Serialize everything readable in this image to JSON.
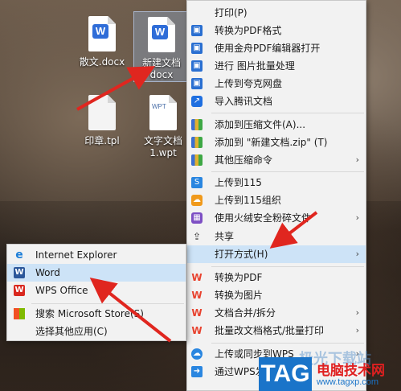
{
  "desktop": {
    "icons": [
      {
        "name": "散文.docx",
        "type": "word"
      },
      {
        "name": "新建文档",
        "name2": "docx",
        "type": "word"
      },
      {
        "name": "印章.tpl",
        "type": "file"
      },
      {
        "name": "文字文档",
        "name2": "1.wpt",
        "type": "wpt"
      }
    ]
  },
  "context_menu": {
    "items": [
      {
        "label": "打印(P)",
        "icon": "none"
      },
      {
        "label": "转换为PDF格式",
        "icon": "pdf-convert-icon"
      },
      {
        "label": "使用金舟PDF编辑器打开",
        "icon": "pdf-editor-icon"
      },
      {
        "label": "进行 图片批量处理",
        "icon": "image-batch-icon"
      },
      {
        "label": "上传到夸克网盘",
        "icon": "quark-cloud-icon"
      },
      {
        "label": "导入腾讯文档",
        "icon": "tencent-docs-icon"
      },
      {
        "label": "添加到压缩文件(A)...",
        "icon": "archive-icon"
      },
      {
        "label": "添加到 \"新建文档.zip\" (T)",
        "icon": "archive-zip-icon"
      },
      {
        "label": "其他压缩命令",
        "icon": "archive-more-icon",
        "submenu": true
      },
      {
        "label": "上传到115",
        "icon": "upload-115-icon"
      },
      {
        "label": "上传到115组织",
        "icon": "upload-115-org-icon"
      },
      {
        "label": "使用火绒安全粉碎文件",
        "icon": "huorong-shred-icon",
        "submenu": true
      },
      {
        "label": "共享",
        "icon": "share-icon"
      },
      {
        "label": "打开方式(H)",
        "icon": "none",
        "submenu": true
      },
      {
        "label": "转换为PDF",
        "icon": "wps-pdf-icon"
      },
      {
        "label": "转换为图片",
        "icon": "wps-image-icon"
      },
      {
        "label": "文档合并/拆分",
        "icon": "wps-merge-icon",
        "submenu": true
      },
      {
        "label": "批量改文档格式/批量打印",
        "icon": "wps-batch-icon",
        "submenu": true
      },
      {
        "label": "上传或同步到WPS",
        "icon": "wps-cloud-icon",
        "submenu": true
      },
      {
        "label": "通过WPS发",
        "icon": "wps-send-icon"
      }
    ],
    "arrow_glyph": "›"
  },
  "open_with_submenu": {
    "items": [
      {
        "label": "Internet Explorer",
        "icon": "internet-explorer-icon"
      },
      {
        "label": "Word",
        "icon": "word-icon"
      },
      {
        "label": "WPS Office",
        "icon": "wps-office-icon"
      },
      {
        "label": "搜索 Microsoft Store(S)",
        "icon": "store-icon"
      },
      {
        "label": "选择其他应用(C)",
        "icon": "none"
      }
    ]
  },
  "watermark": {
    "tag": "TAG",
    "title": "电脑技术网",
    "url": "www.tagxp.com",
    "faint_text": "极光下载站"
  },
  "colors": {
    "highlight": "#cde3f7",
    "arrow": "#e0261f",
    "wps_red": "#e8422e",
    "accent_blue": "#1a74c9"
  }
}
